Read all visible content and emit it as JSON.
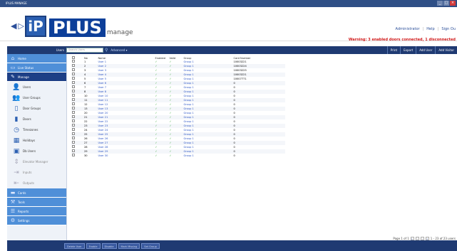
{
  "window": {
    "title": "IPLUS MANAGE"
  },
  "header": {
    "logo_ip": "iP",
    "logo_plus": "PLUS",
    "logo_manage": "manage",
    "links": {
      "user": "Administrator",
      "help": "Help",
      "signout": "Sign Ou"
    },
    "warning": "Warning: 3 enabled doors connected, 1 disconnected"
  },
  "toolbar": {
    "filter_label": "Users",
    "search_placeholder": "Search Users",
    "advanced_label": "Advanced",
    "actions": [
      "Print",
      "Export",
      "Add User",
      "Add Visitor"
    ]
  },
  "sidebar": {
    "nav": [
      {
        "label": "Home",
        "icon": "home-icon"
      },
      {
        "label": "Live Status",
        "icon": "monitor-icon"
      },
      {
        "label": "Manage",
        "icon": "edit-icon",
        "active": true
      }
    ],
    "subitems": [
      {
        "label": "Users",
        "icon": "user-icon",
        "disabled": false
      },
      {
        "label": "User Groups",
        "icon": "user-group-icon",
        "disabled": false
      },
      {
        "label": "Door Groups",
        "icon": "door-icon",
        "disabled": false
      },
      {
        "label": "Doors",
        "icon": "door-single-icon",
        "disabled": false
      },
      {
        "label": "Timezones",
        "icon": "clock-icon",
        "disabled": false
      },
      {
        "label": "Holidays",
        "icon": "calendar-icon",
        "disabled": false
      },
      {
        "label": "Db Users",
        "icon": "db-user-icon",
        "disabled": false
      },
      {
        "label": "Elevator Manager",
        "icon": "elevator-icon",
        "disabled": true
      },
      {
        "label": "Inputs",
        "icon": "input-icon",
        "disabled": true
      },
      {
        "label": "Outputs",
        "icon": "output-icon",
        "disabled": true
      }
    ],
    "nav_bottom": [
      {
        "label": "Cards",
        "icon": "card-icon"
      },
      {
        "label": "Tools",
        "icon": "wrench-icon"
      },
      {
        "label": "Reports",
        "icon": "report-icon"
      },
      {
        "label": "Settings",
        "icon": "settings-icon"
      }
    ]
  },
  "table": {
    "headers": [
      "No",
      "Name",
      "Enabled",
      "Valid",
      "Group",
      "Card Number"
    ],
    "rows": [
      {
        "no": "1",
        "name": "User 1",
        "enabled": "✓",
        "valid": "✓",
        "group": "Group 1",
        "card": "10003221"
      },
      {
        "no": "2",
        "name": "User 2",
        "enabled": "✓",
        "valid": "✓",
        "group": "Group 1",
        "card": "10003224"
      },
      {
        "no": "3",
        "name": "User 3",
        "enabled": "✓",
        "valid": "✓",
        "group": "Group 1",
        "card": "10003225"
      },
      {
        "no": "4",
        "name": "User 4",
        "enabled": "✓",
        "valid": "✓",
        "group": "Group 1",
        "card": "10003221"
      },
      {
        "no": "5",
        "name": "User 5",
        "enabled": "✓",
        "valid": "✓",
        "group": "Group 1",
        "card": "10007771"
      },
      {
        "no": "6",
        "name": "User 6",
        "enabled": "✓",
        "valid": "✓",
        "group": "Group 1",
        "card": "0"
      },
      {
        "no": "7",
        "name": "User 7",
        "enabled": "✓",
        "valid": "✓",
        "group": "Group 1",
        "card": "0"
      },
      {
        "no": "8",
        "name": "User 8",
        "enabled": "✓",
        "valid": "✓",
        "group": "Group 1",
        "card": "0"
      },
      {
        "no": "10",
        "name": "User 10",
        "enabled": "✓",
        "valid": "✓",
        "group": "Group 1",
        "card": "0"
      },
      {
        "no": "11",
        "name": "User 11",
        "enabled": "✓",
        "valid": "✓",
        "group": "Group 1",
        "card": "0"
      },
      {
        "no": "12",
        "name": "User 12",
        "enabled": "✓",
        "valid": "✓",
        "group": "Group 1",
        "card": "0"
      },
      {
        "no": "13",
        "name": "User 13",
        "enabled": "✓",
        "valid": "✓",
        "group": "Group 1",
        "card": "0"
      },
      {
        "no": "20",
        "name": "User 20",
        "enabled": "✓",
        "valid": "✓",
        "group": "Group 1",
        "card": "0"
      },
      {
        "no": "21",
        "name": "User 21",
        "enabled": "✓",
        "valid": "✓",
        "group": "Group 1",
        "card": "0"
      },
      {
        "no": "22",
        "name": "User 22",
        "enabled": "✓",
        "valid": "✓",
        "group": "Group 1",
        "card": "0"
      },
      {
        "no": "23",
        "name": "User 23",
        "enabled": "✓",
        "valid": "✓",
        "group": "Group 1",
        "card": "0"
      },
      {
        "no": "24",
        "name": "User 24",
        "enabled": "✓",
        "valid": "✓",
        "group": "Group 1",
        "card": "0"
      },
      {
        "no": "25",
        "name": "User 25",
        "enabled": "✓",
        "valid": "✓",
        "group": "Group 1",
        "card": "0"
      },
      {
        "no": "26",
        "name": "User 26",
        "enabled": "✓",
        "valid": "✓",
        "group": "Group 1",
        "card": "0"
      },
      {
        "no": "27",
        "name": "User 27",
        "enabled": "✓",
        "valid": "✓",
        "group": "Group 1",
        "card": "0"
      },
      {
        "no": "28",
        "name": "User 28",
        "enabled": "✓",
        "valid": "✓",
        "group": "Group 1",
        "card": "0"
      },
      {
        "no": "29",
        "name": "User 29",
        "enabled": "✓",
        "valid": "✓",
        "group": "Group 1",
        "card": "0"
      },
      {
        "no": "30",
        "name": "User 30",
        "enabled": "✓",
        "valid": "✓",
        "group": "Group 1",
        "card": "0"
      }
    ]
  },
  "pager": {
    "text": "Page 1 of 1",
    "count": "1 - 23 of 23 users"
  },
  "bottombar": {
    "buttons": [
      "Delete User",
      "Enable",
      "Disable",
      "Mark Missing",
      "Set Group"
    ]
  },
  "colors": {
    "navy": "#1f3a72",
    "nav_blue": "#4f8fd8",
    "link": "#2b55c5",
    "warning": "#d01a1a",
    "check": "#3aa83a"
  }
}
